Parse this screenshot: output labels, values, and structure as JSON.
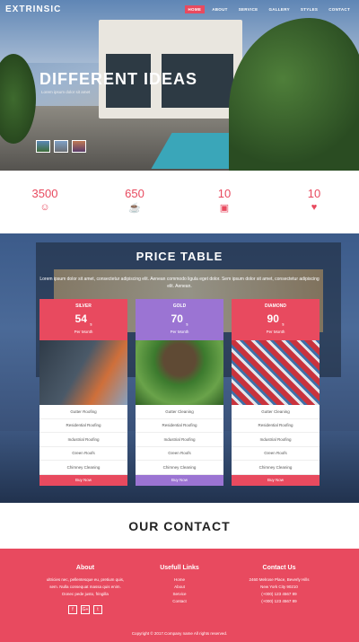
{
  "nav": {
    "logo": "EXTRINSIC",
    "menu": [
      "HOME",
      "ABOUT",
      "SERVICE",
      "GALLERY",
      "STYLES",
      "CONTACT"
    ]
  },
  "hero": {
    "title": "DIFFERENT IDEAS",
    "subtitle": "Lorem ipsum dolor sit amet"
  },
  "stats": [
    {
      "value": "3500",
      "icon": "smile-icon"
    },
    {
      "value": "650",
      "icon": "coffee-icon"
    },
    {
      "value": "10",
      "icon": "gift-icon"
    },
    {
      "value": "10",
      "icon": "heartbeat-icon"
    }
  ],
  "pricing": {
    "title": "PRICE TABLE",
    "description": "Lorem ipsum dolor sit amet, consectetur adipiscing elit. Aenean commodo ligula eget dolor. Sem ipsum dolor sit amet, consectetur adipiscing elit. Aenean.",
    "plans": [
      {
        "name": "SILVER",
        "price": "54",
        "currency": "$",
        "period": "Per Month",
        "features": [
          "Gutter Roofing",
          "Residential Roofing",
          "Industrial Roofing",
          "Green Roofs",
          "Chimney Cleaning"
        ],
        "buy_label": "Buy Now"
      },
      {
        "name": "GOLD",
        "price": "70",
        "currency": "$",
        "period": "Per Month",
        "features": [
          "Gutter Cleaning",
          "Residential Roofing",
          "Industrial Roofing",
          "Green Roofs",
          "Chimney Cleaning"
        ],
        "buy_label": "Buy Now"
      },
      {
        "name": "DIAMOND",
        "price": "90",
        "currency": "$",
        "period": "Per Month",
        "features": [
          "Gutter Cleaning",
          "Residential Roofing",
          "Industrial Roofing",
          "Green Roofs",
          "Chimney Cleaning"
        ],
        "buy_label": "Buy Now"
      }
    ]
  },
  "contact": {
    "title": "OUR CONTACT"
  },
  "footer": {
    "about_title": "About",
    "about_text": [
      "ultricies nec, pellentesque eu, pretium quis,",
      "sem. Nulla consequat massa quis enim.",
      "Donec pede justo, fringilla"
    ],
    "links_title": "Usefull Links",
    "links": [
      "Home",
      "About",
      "Service",
      "Contact"
    ],
    "contact_title": "Contact Us",
    "contact_lines": [
      "2460 Melrose Place, Beverly Hills",
      "New York City 90210",
      "(+000) 123 4567 89",
      "(+000) 123 4567 89"
    ],
    "copyright": "Copyright © 2017.Company name All rights reserved."
  },
  "colors": {
    "accent": "#e84a5f",
    "gold": "#9b74d3"
  }
}
